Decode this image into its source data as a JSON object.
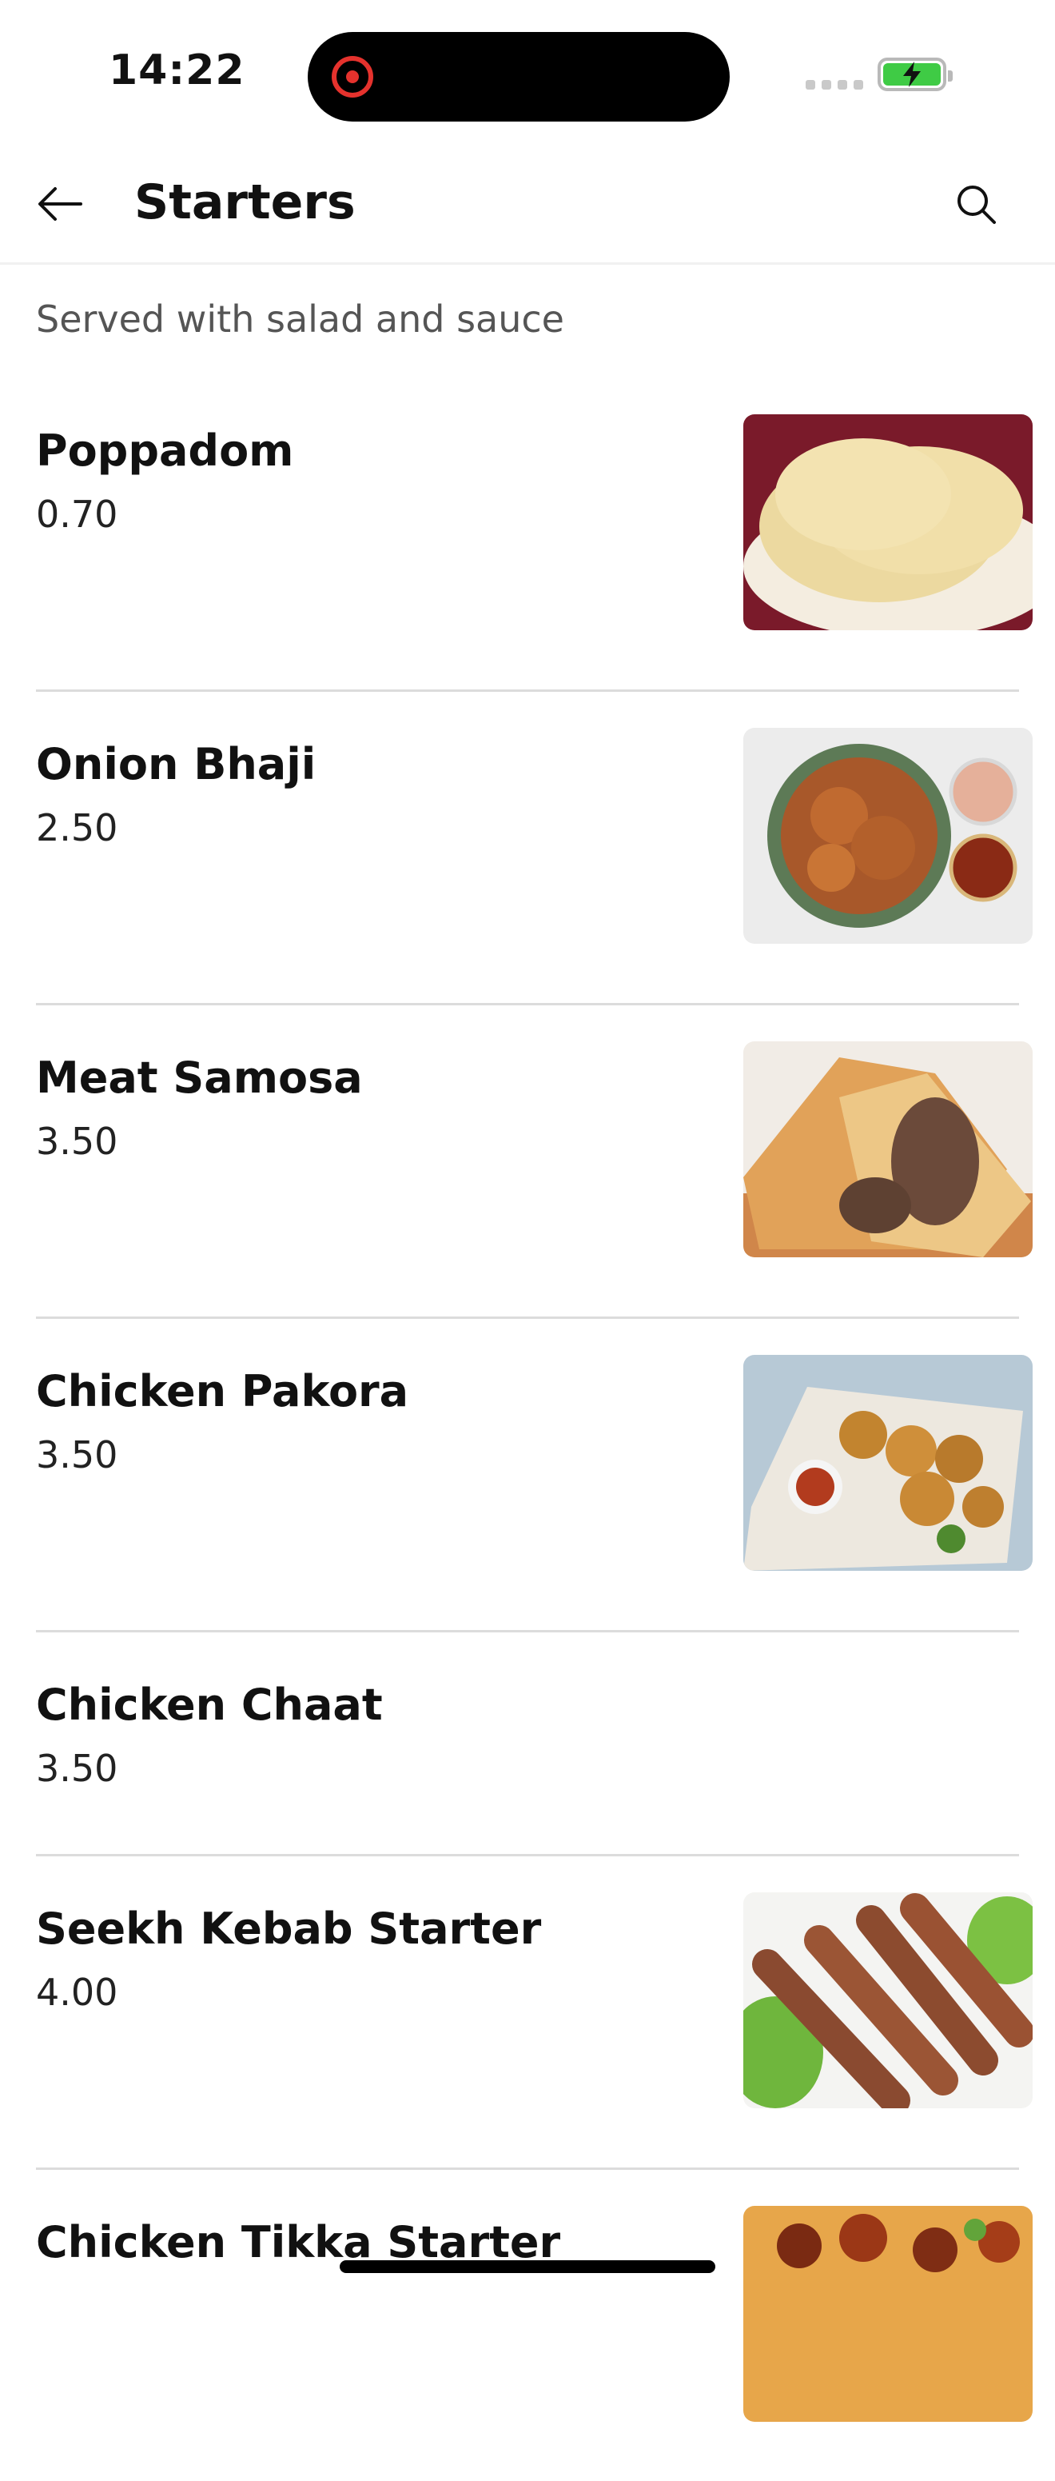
{
  "status": {
    "time": "14:22",
    "battery_color": "#3fcb45",
    "recording_color": "#e5322d"
  },
  "header": {
    "title": "Starters",
    "back_icon": "arrow-left-icon",
    "search_icon": "search-icon"
  },
  "subtitle": "Served with salad and sauce",
  "items": [
    {
      "name": "Poppadom",
      "price": "0.70",
      "image": "poppadom-photo"
    },
    {
      "name": "Onion Bhaji",
      "price": "2.50",
      "image": "onion-bhaji-photo"
    },
    {
      "name": "Meat Samosa",
      "price": "3.50",
      "image": "meat-samosa-photo"
    },
    {
      "name": "Chicken Pakora",
      "price": "3.50",
      "image": "chicken-pakora-photo"
    },
    {
      "name": "Chicken Chaat",
      "price": "3.50",
      "image": null
    },
    {
      "name": "Seekh Kebab Starter",
      "price": "4.00",
      "image": "seekh-kebab-photo"
    },
    {
      "name": "Chicken Tikka Starter",
      "price": "",
      "image": "chicken-tikka-photo"
    }
  ]
}
